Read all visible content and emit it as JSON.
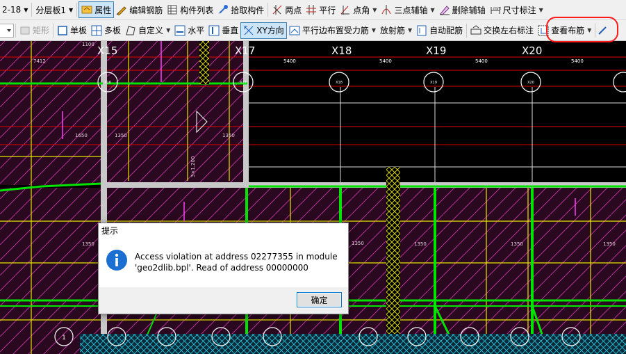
{
  "toolbar1": {
    "floor_combo": "2-18",
    "layer_combo": "分层板1",
    "items": [
      {
        "label": "属性",
        "icon": "property-icon"
      },
      {
        "label": "编辑钢筋",
        "icon": "edit-rebar-icon"
      },
      {
        "label": "构件列表",
        "icon": "component-list-icon"
      },
      {
        "label": "拾取构件",
        "icon": "pick-component-icon"
      },
      {
        "label": "两点",
        "icon": "two-point-icon"
      },
      {
        "label": "平行",
        "icon": "parallel-icon"
      },
      {
        "label": "点角",
        "icon": "point-angle-icon"
      },
      {
        "label": "三点辅轴",
        "icon": "three-point-axis-icon"
      },
      {
        "label": "删除辅轴",
        "icon": "delete-axis-icon"
      },
      {
        "label": "尺寸标注",
        "icon": "dimension-icon"
      }
    ]
  },
  "toolbar2": {
    "items": [
      {
        "label": "矩形",
        "icon": "rectangle-icon"
      },
      {
        "label": "单板",
        "icon": "single-slab-icon"
      },
      {
        "label": "多板",
        "icon": "multi-slab-icon"
      },
      {
        "label": "自定义",
        "icon": "custom-icon"
      },
      {
        "label": "水平",
        "icon": "horizontal-icon"
      },
      {
        "label": "垂直",
        "icon": "vertical-icon"
      },
      {
        "label": "XY方向",
        "icon": "xy-direction-icon"
      },
      {
        "label": "平行边布置受力筋",
        "icon": "parallel-edge-rebar-icon"
      },
      {
        "label": "放射筋",
        "icon": "radial-rebar-icon"
      },
      {
        "label": "自动配筋",
        "icon": "auto-rebar-icon"
      },
      {
        "label": "交换左右标注",
        "icon": "swap-labels-icon"
      },
      {
        "label": "查看布筋",
        "icon": "view-rebar-icon"
      }
    ]
  },
  "cad": {
    "axis_labels": [
      "X15",
      "X17",
      "X18",
      "X19",
      "X20"
    ],
    "small_axis_labels": [
      "X16",
      "X17",
      "X18",
      "X19",
      "X20"
    ],
    "span_dims": [
      "5400",
      "5400",
      "5400",
      "5400"
    ],
    "top_dims": [
      "7412",
      "1100"
    ],
    "rebar_dims": [
      "1650",
      "1350",
      "1350",
      "1350",
      "1350",
      "1350",
      "1350",
      "1350"
    ],
    "vertical_dim": "3×1.200",
    "bottom_axis": "1"
  },
  "dialog": {
    "title": "提示",
    "message_line1": "Access violation at address 02277355 in module",
    "message_line2": "'geo2dlib.bpl'. Read of address 00000000",
    "ok_label": "确定",
    "icon": "info-icon"
  },
  "colors": {
    "cad_background": "#000000",
    "slab_hatch": "#b4309a",
    "slab_fill": "#2a0820",
    "beam_green": "#00e400",
    "axis_line_red": "#e00000",
    "grid_yellow": "#e6e600",
    "highlight_ring": "#ff1a1a",
    "dialog_info_blue": "#1b6fd1"
  }
}
